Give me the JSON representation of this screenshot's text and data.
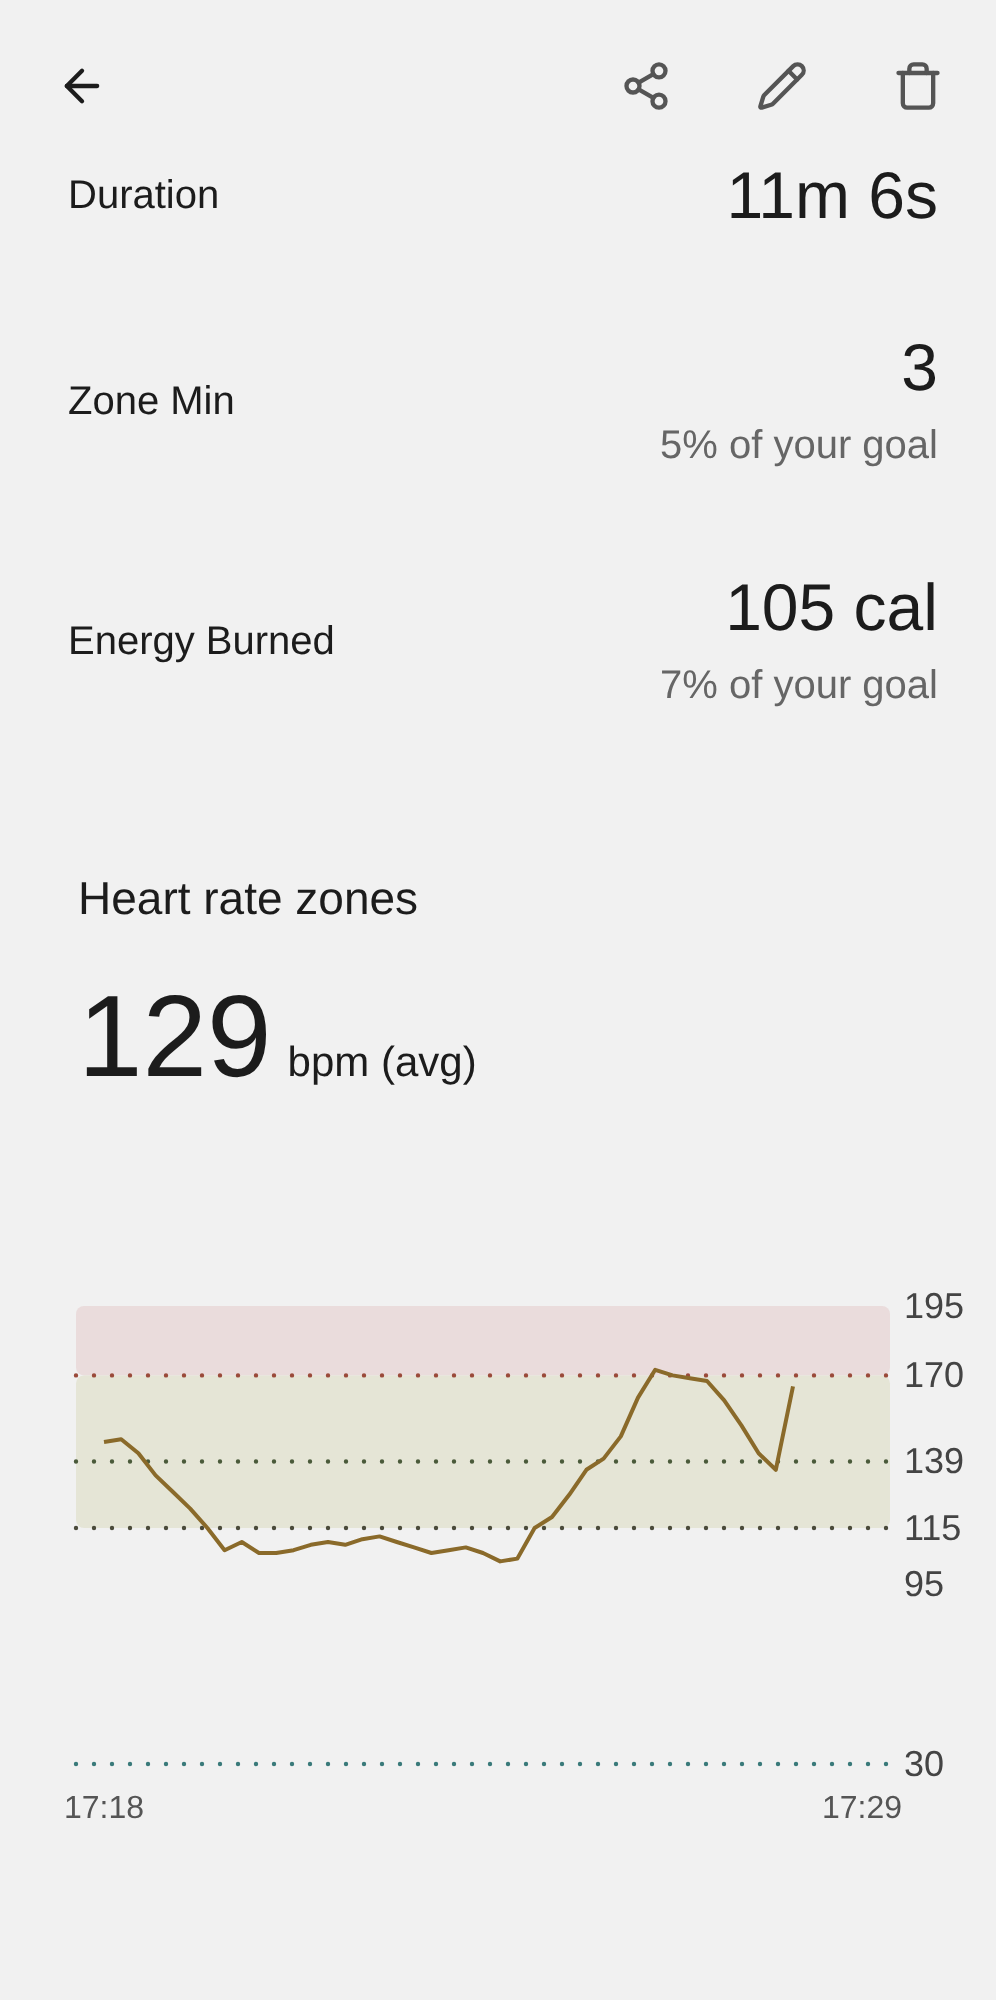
{
  "toolbar": {
    "actions": [
      {
        "kind": "share"
      },
      {
        "kind": "edit"
      },
      {
        "kind": "delete"
      }
    ]
  },
  "stats": [
    {
      "label": "Duration",
      "value": "11m 6s"
    },
    {
      "label": "Zone Min",
      "value": "3",
      "note": "5% of your goal"
    },
    {
      "label": "Energy Burned",
      "value": "105 cal",
      "note": "7% of your goal"
    }
  ],
  "heart_rate": {
    "title": "Heart rate zones",
    "average": "129",
    "unit": "bpm (avg)",
    "chart_data": {
      "type": "line",
      "categories": [
        "17:18",
        null,
        null,
        null,
        null,
        null,
        null,
        null,
        null,
        null,
        null,
        null,
        null,
        null,
        null,
        null,
        null,
        null,
        null,
        null,
        null,
        null,
        null,
        null,
        null,
        null,
        null,
        null,
        null,
        null,
        null,
        null,
        null,
        null,
        null,
        null,
        null,
        null,
        null,
        null,
        null,
        null,
        null,
        null,
        "17:29"
      ],
      "series": [
        {
          "color": "#8a6a2a",
          "values": [
            146,
            147,
            142,
            134,
            128,
            122,
            115,
            107,
            110,
            106,
            106,
            107,
            109,
            110,
            109,
            111,
            112,
            110,
            108,
            106,
            107,
            108,
            106,
            103,
            104,
            115,
            119,
            127,
            136,
            140,
            148,
            162,
            172,
            170,
            169,
            168,
            161,
            152,
            142,
            136,
            166,
            null,
            null,
            null,
            null
          ]
        }
      ],
      "ylim": [
        30,
        195
      ],
      "yticks": [
        195,
        170,
        139,
        115,
        95,
        30
      ],
      "bands": [
        {
          "axis": "y",
          "from": 170,
          "to": 195,
          "color": "#eadcdc"
        },
        {
          "axis": "y",
          "from": 115,
          "to": 170,
          "color": "#e5e5d6"
        }
      ],
      "ref_lines": [
        {
          "axis": "y",
          "value": 170,
          "color": "#9a4a3a"
        },
        {
          "axis": "y",
          "value": 139,
          "color": "#4a5a3a"
        },
        {
          "axis": "y",
          "value": 115,
          "color": "#4a4a3a"
        },
        {
          "axis": "y",
          "value": 30,
          "color": "#3a7a7a"
        }
      ]
    }
  }
}
